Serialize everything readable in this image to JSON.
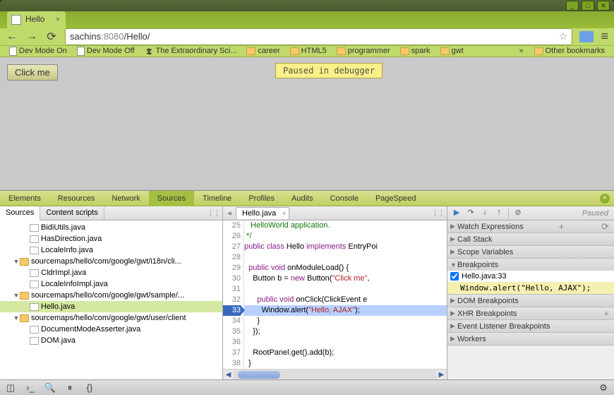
{
  "window": {
    "min": "_",
    "max": "□",
    "close": "✕"
  },
  "browser": {
    "tab_title": "Hello",
    "url_host": "sachins",
    "url_port": ":8080",
    "url_path": "/Hello/",
    "bookmarks": [
      {
        "label": "Dev Mode On",
        "icon": "doc"
      },
      {
        "label": "Dev Mode Off",
        "icon": "doc"
      },
      {
        "label": "The Extraordinary Sci...",
        "icon": "nyt"
      },
      {
        "label": "career",
        "icon": "folder"
      },
      {
        "label": "HTML5",
        "icon": "folder"
      },
      {
        "label": "programmer",
        "icon": "folder"
      },
      {
        "label": "spark",
        "icon": "folder"
      },
      {
        "label": "gwt",
        "icon": "folder"
      }
    ],
    "other_bookmarks": "Other bookmarks"
  },
  "page": {
    "button": "Click me",
    "paused": "Paused in debugger"
  },
  "devtools": {
    "tabs": [
      "Elements",
      "Resources",
      "Network",
      "Sources",
      "Timeline",
      "Profiles",
      "Audits",
      "Console",
      "PageSpeed"
    ],
    "active_tab": "Sources",
    "left_tabs": [
      "Sources",
      "Content scripts"
    ],
    "tree": [
      {
        "d": 2,
        "t": "file",
        "label": "BidiUtils.java"
      },
      {
        "d": 2,
        "t": "file",
        "label": "HasDirection.java"
      },
      {
        "d": 2,
        "t": "file",
        "label": "LocaleInfo.java"
      },
      {
        "d": 1,
        "t": "folder",
        "exp": true,
        "label": "sourcemaps/hello/com/google/gwt/i18n/cli..."
      },
      {
        "d": 2,
        "t": "file",
        "label": "CldrImpl.java"
      },
      {
        "d": 2,
        "t": "file",
        "label": "LocaleInfoImpl.java"
      },
      {
        "d": 1,
        "t": "folder",
        "exp": true,
        "label": "sourcemaps/hello/com/google/gwt/sample/..."
      },
      {
        "d": 2,
        "t": "file",
        "label": "Hello.java",
        "sel": true
      },
      {
        "d": 1,
        "t": "folder",
        "exp": true,
        "label": "sourcemaps/hello/com/google/gwt/user/client"
      },
      {
        "d": 2,
        "t": "file",
        "label": "DocumentModeAsserter.java"
      },
      {
        "d": 2,
        "t": "file",
        "label": "DOM.java"
      }
    ],
    "open_file": "Hello.java",
    "code": {
      "start": 25,
      "lines": [
        {
          "n": 25,
          "html": "<span class='c'>   HelloWorld application.</span>"
        },
        {
          "n": 26,
          "html": "<span class='c'> */</span>"
        },
        {
          "n": 27,
          "html": "<span class='k'>public</span> <span class='k'>class</span> Hello <span class='k'>implements</span> EntryPoi"
        },
        {
          "n": 28,
          "html": ""
        },
        {
          "n": 29,
          "html": "  <span class='k'>public</span> <span class='k'>void</span> onModuleLoad() {"
        },
        {
          "n": 30,
          "html": "    Button b = <span class='k'>new</span> Button(<span class='s'>\"Click me\"</span>, "
        },
        {
          "n": 31,
          "html": ""
        },
        {
          "n": 32,
          "html": "      <span class='k'>public</span> <span class='k'>void</span> onClick(ClickEvent e"
        },
        {
          "n": 33,
          "html": "        Window.alert(<span class='s'>\"Hello, AJAX\"</span>);",
          "bp": true,
          "hl": true
        },
        {
          "n": 34,
          "html": "      }"
        },
        {
          "n": 35,
          "html": "    });"
        },
        {
          "n": 36,
          "html": ""
        },
        {
          "n": 37,
          "html": "    RootPanel.get().add(b);"
        },
        {
          "n": 38,
          "html": "  }"
        }
      ]
    },
    "right": {
      "paused": "Paused",
      "sections": {
        "watch": "Watch Expressions",
        "callstack": "Call Stack",
        "scope": "Scope Variables",
        "breakpoints": "Breakpoints",
        "dom": "DOM Breakpoints",
        "xhr": "XHR Breakpoints",
        "event": "Event Listener Breakpoints",
        "workers": "Workers"
      },
      "bp_label": "Hello.java:33",
      "bp_code": "Window.alert(\"Hello, AJAX\");"
    }
  }
}
